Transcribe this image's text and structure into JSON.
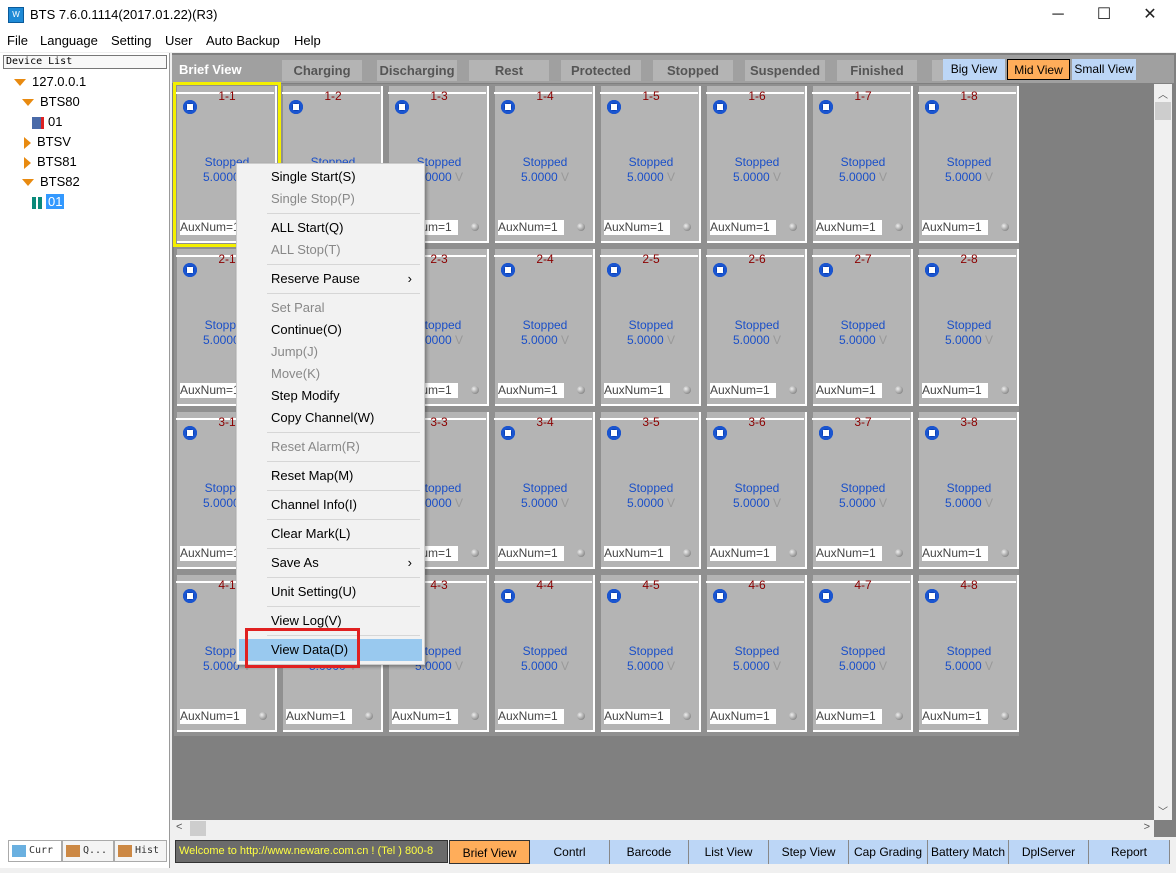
{
  "window": {
    "title": "BTS 7.6.0.1114(2017.01.22)(R3)",
    "minimize": "─",
    "maximize": "☐",
    "close": "✕"
  },
  "menubar": [
    "File",
    "Language",
    "Setting",
    "User",
    "Auto Backup",
    "Help"
  ],
  "left_panel": {
    "header": "Device List",
    "tree": [
      {
        "label": "127.0.0.1",
        "level": 0,
        "state": "expanded"
      },
      {
        "label": "BTS80",
        "level": 1,
        "state": "expanded"
      },
      {
        "label": "01",
        "level": 2,
        "state": "disconnected"
      },
      {
        "label": "BTSV",
        "level": 1,
        "state": "collapsed"
      },
      {
        "label": "BTS81",
        "level": 1,
        "state": "collapsed"
      },
      {
        "label": "BTS82",
        "level": 1,
        "state": "expanded"
      },
      {
        "label": "01",
        "level": 2,
        "state": "selected"
      }
    ],
    "tabs": [
      "Curr",
      "Q...",
      "Hist"
    ]
  },
  "header": {
    "title": "Brief View",
    "filters": [
      "Charging",
      "Discharging",
      "Rest",
      "Protected",
      "Stopped",
      "Suspended",
      "Finished"
    ],
    "views": [
      {
        "label": "Big View",
        "active": false
      },
      {
        "label": "Mid View",
        "active": true
      },
      {
        "label": "Small View",
        "active": false
      }
    ]
  },
  "channels": {
    "rows": [
      1,
      2,
      3,
      4
    ],
    "cols": [
      1,
      2,
      3,
      4,
      5,
      6,
      7,
      8
    ],
    "status": "Stopped",
    "voltage": "5.0000",
    "unit": "V",
    "aux": "AuxNum=1",
    "selected": "1-1"
  },
  "status_bar": {
    "welcome": "Welcome to http://www.neware.com.cn !    (Tel ) 800-8"
  },
  "bottom_buttons": [
    {
      "label": "Brief View",
      "active": true
    },
    {
      "label": "Contrl"
    },
    {
      "label": "Barcode"
    },
    {
      "label": "List View"
    },
    {
      "label": "Step View"
    },
    {
      "label": "Cap Grading"
    },
    {
      "label": "Battery Match"
    },
    {
      "label": "DplServer"
    },
    {
      "label": "Report"
    }
  ],
  "context_menu": [
    {
      "label": "Single Start(S)"
    },
    {
      "label": "Single Stop(P)",
      "disabled": true
    },
    {
      "sep": true
    },
    {
      "label": "ALL Start(Q)"
    },
    {
      "label": "ALL Stop(T)",
      "disabled": true
    },
    {
      "sep": true
    },
    {
      "label": "Reserve Pause",
      "submenu": true
    },
    {
      "sep": true
    },
    {
      "label": "Set Paral",
      "disabled": true
    },
    {
      "label": "Continue(O)"
    },
    {
      "label": "Jump(J)",
      "disabled": true
    },
    {
      "label": "Move(K)",
      "disabled": true
    },
    {
      "label": "Step Modify"
    },
    {
      "label": "Copy Channel(W)"
    },
    {
      "sep": true
    },
    {
      "label": "Reset Alarm(R)",
      "disabled": true
    },
    {
      "sep": true
    },
    {
      "label": "Reset Map(M)"
    },
    {
      "sep": true
    },
    {
      "label": "Channel Info(I)"
    },
    {
      "sep": true
    },
    {
      "label": "Clear Mark(L)"
    },
    {
      "sep": true
    },
    {
      "label": "Save As",
      "submenu": true
    },
    {
      "sep": true
    },
    {
      "label": "Unit Setting(U)"
    },
    {
      "sep": true
    },
    {
      "label": "View Log(V)"
    },
    {
      "sep": true
    },
    {
      "label": "View Data(D)",
      "highlighted": true
    }
  ],
  "colors": {
    "accent_orange": "#ffad5a",
    "button_blue": "#bcd6f6",
    "menu_highlight": "#99c9ef",
    "callout_red": "#e02020"
  }
}
